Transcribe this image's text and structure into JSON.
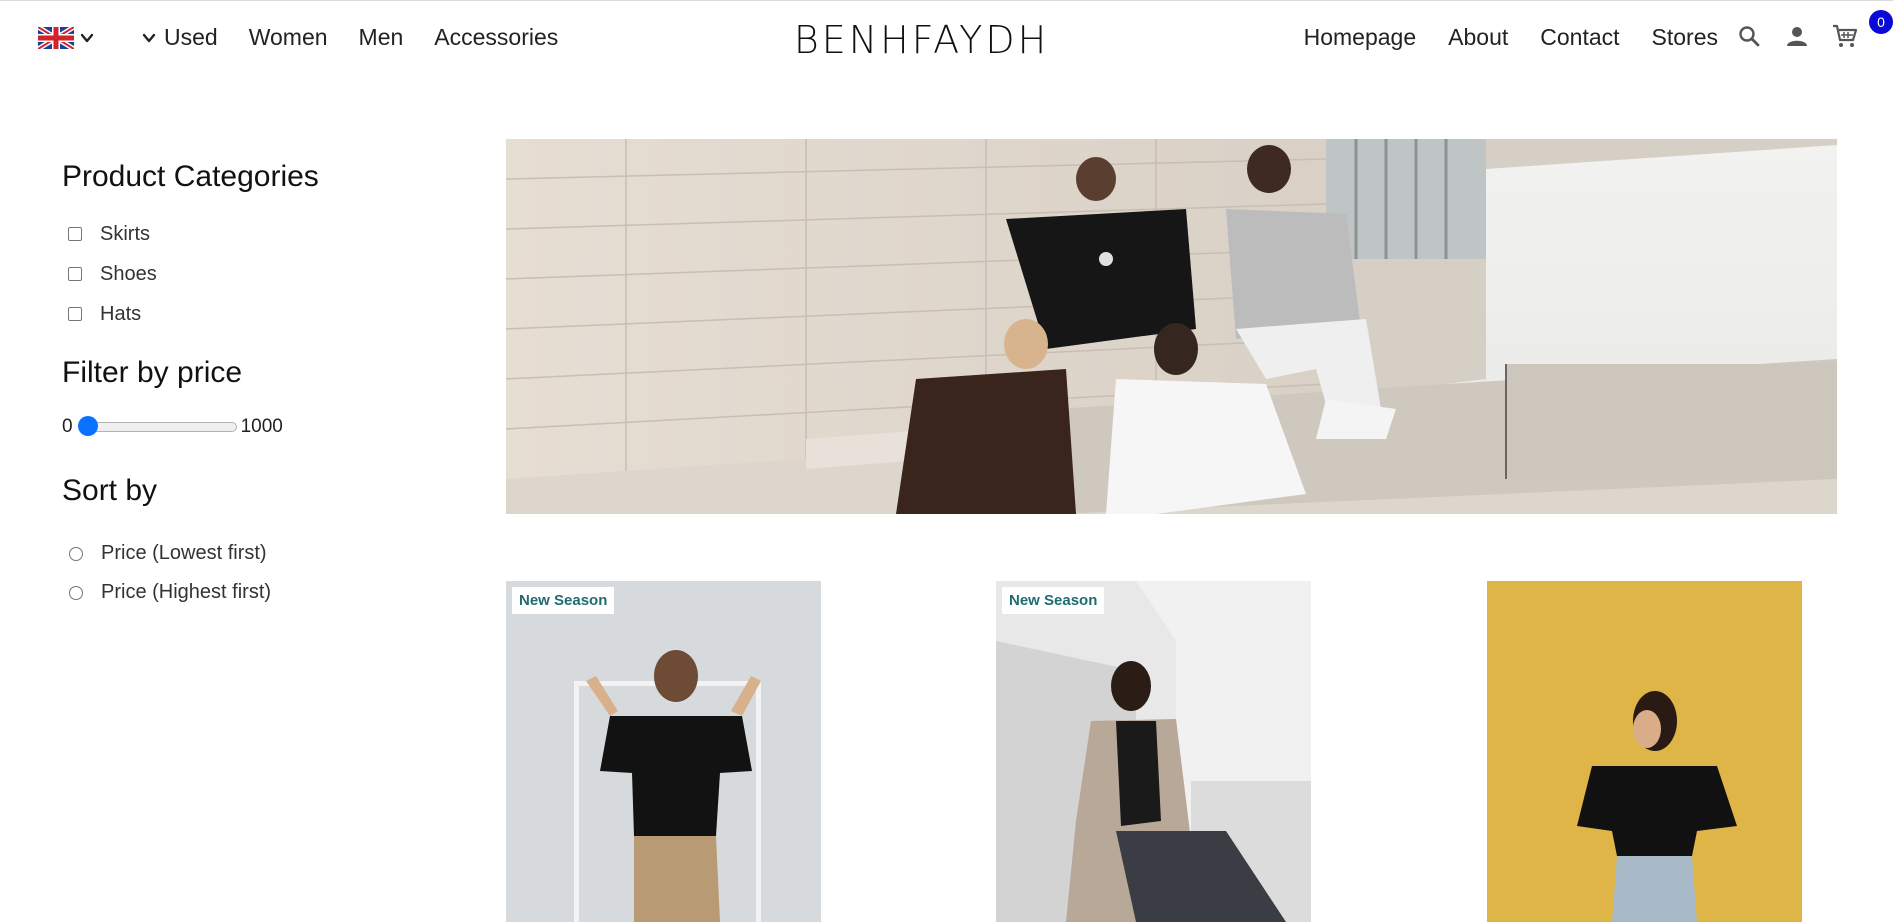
{
  "header": {
    "brand": "BENHFAYDH",
    "nav_left": [
      {
        "label": "Used",
        "has_chevron": true
      },
      {
        "label": "Women"
      },
      {
        "label": "Men"
      },
      {
        "label": "Accessories"
      }
    ],
    "nav_right": [
      {
        "label": "Homepage"
      },
      {
        "label": "About"
      },
      {
        "label": "Contact"
      },
      {
        "label": "Stores"
      }
    ],
    "icons": [
      "search-icon",
      "user-icon",
      "cart-icon"
    ],
    "cart_count": "0",
    "language_flag": "uk-flag-icon"
  },
  "sidebar": {
    "categories_title": "Product Categories",
    "categories": [
      {
        "label": "Skirts",
        "checked": false
      },
      {
        "label": "Shoes",
        "checked": false
      },
      {
        "label": "Hats",
        "checked": false
      }
    ],
    "price_title": "Filter by price",
    "price_min": "0",
    "price_max": "1000",
    "price_value": 0,
    "sort_title": "Sort by",
    "sort_options": [
      {
        "label": "Price (Lowest first)",
        "selected": false
      },
      {
        "label": "Price (Highest first)",
        "selected": false
      }
    ]
  },
  "products": [
    {
      "tag": "New Season"
    },
    {
      "tag": "New Season"
    },
    {
      "tag": ""
    }
  ],
  "colors": {
    "accent": "#0a72ff",
    "badge": "#0a0ad8",
    "tag_text": "#1f6c70",
    "p3_background": "#e0b547"
  }
}
